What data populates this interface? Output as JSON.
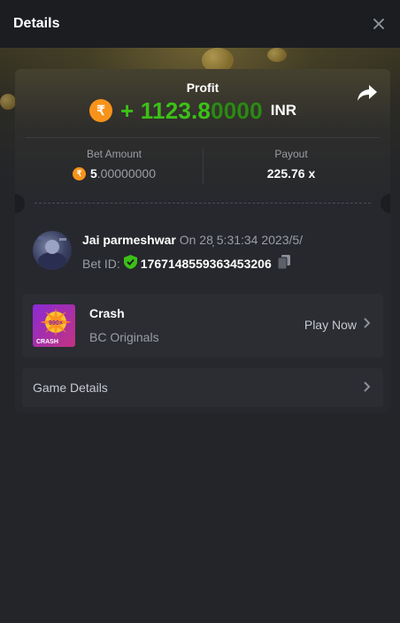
{
  "header": {
    "title": "Details"
  },
  "profit": {
    "label": "Profit",
    "amount_main": "+ 1123.8",
    "amount_faded": "0000",
    "currency": "INR",
    "currency_symbol": "₹"
  },
  "bet": {
    "label": "Bet Amount",
    "value_main": "5",
    "value_rest": ".00000000",
    "currency_symbol": "₹"
  },
  "payout": {
    "label": "Payout",
    "value": "225.76 x"
  },
  "user": {
    "name": "Jai parmeshwar",
    "time_text": "On 28̦ 5:31:34 2023/5/",
    "bet_id_label": "Bet ID:",
    "bet_id": "1767148559363453206"
  },
  "game": {
    "name": "Crash",
    "provider": "BC Originals",
    "play_label": "Play Now",
    "thumb_badge": "990×",
    "thumb_text": "CRASH"
  },
  "details": {
    "label": "Game Details"
  },
  "colors": {
    "profit_green": "#3bc117",
    "rupee_orange": "#f7931a",
    "background": "#232529"
  },
  "icons": [
    "close-icon",
    "share-icon",
    "rupee-icon",
    "shield-check-icon",
    "copy-icon",
    "chevron-right-icon"
  ]
}
